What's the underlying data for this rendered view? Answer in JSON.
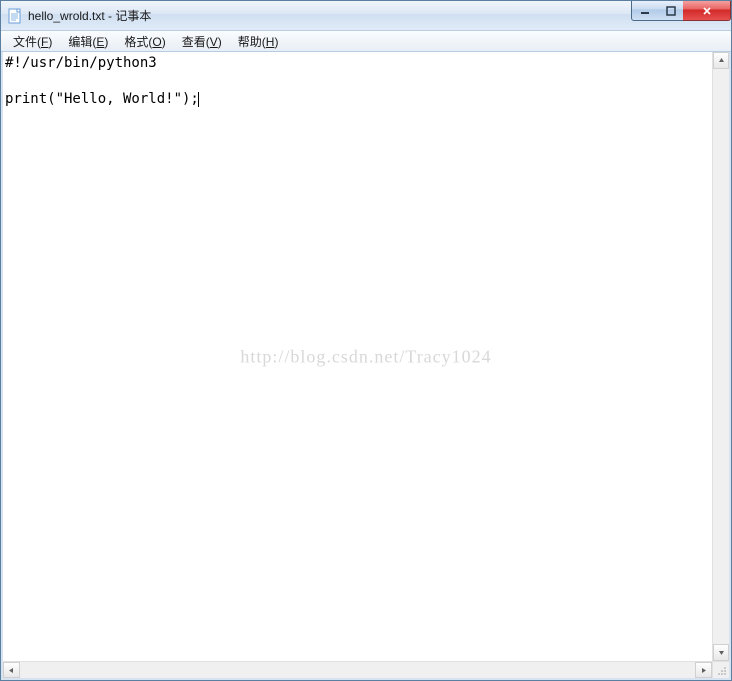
{
  "window": {
    "title": "hello_wrold.txt - 记事本"
  },
  "menu": {
    "file": {
      "label": "文件",
      "mn": "F"
    },
    "edit": {
      "label": "编辑",
      "mn": "E"
    },
    "format": {
      "label": "格式",
      "mn": "O"
    },
    "view": {
      "label": "查看",
      "mn": "V"
    },
    "help": {
      "label": "帮助",
      "mn": "H"
    }
  },
  "editor": {
    "content": "#!/usr/bin/python3\n\nprint(\"Hello, World!\");"
  },
  "watermark": "http://blog.csdn.net/Tracy1024"
}
